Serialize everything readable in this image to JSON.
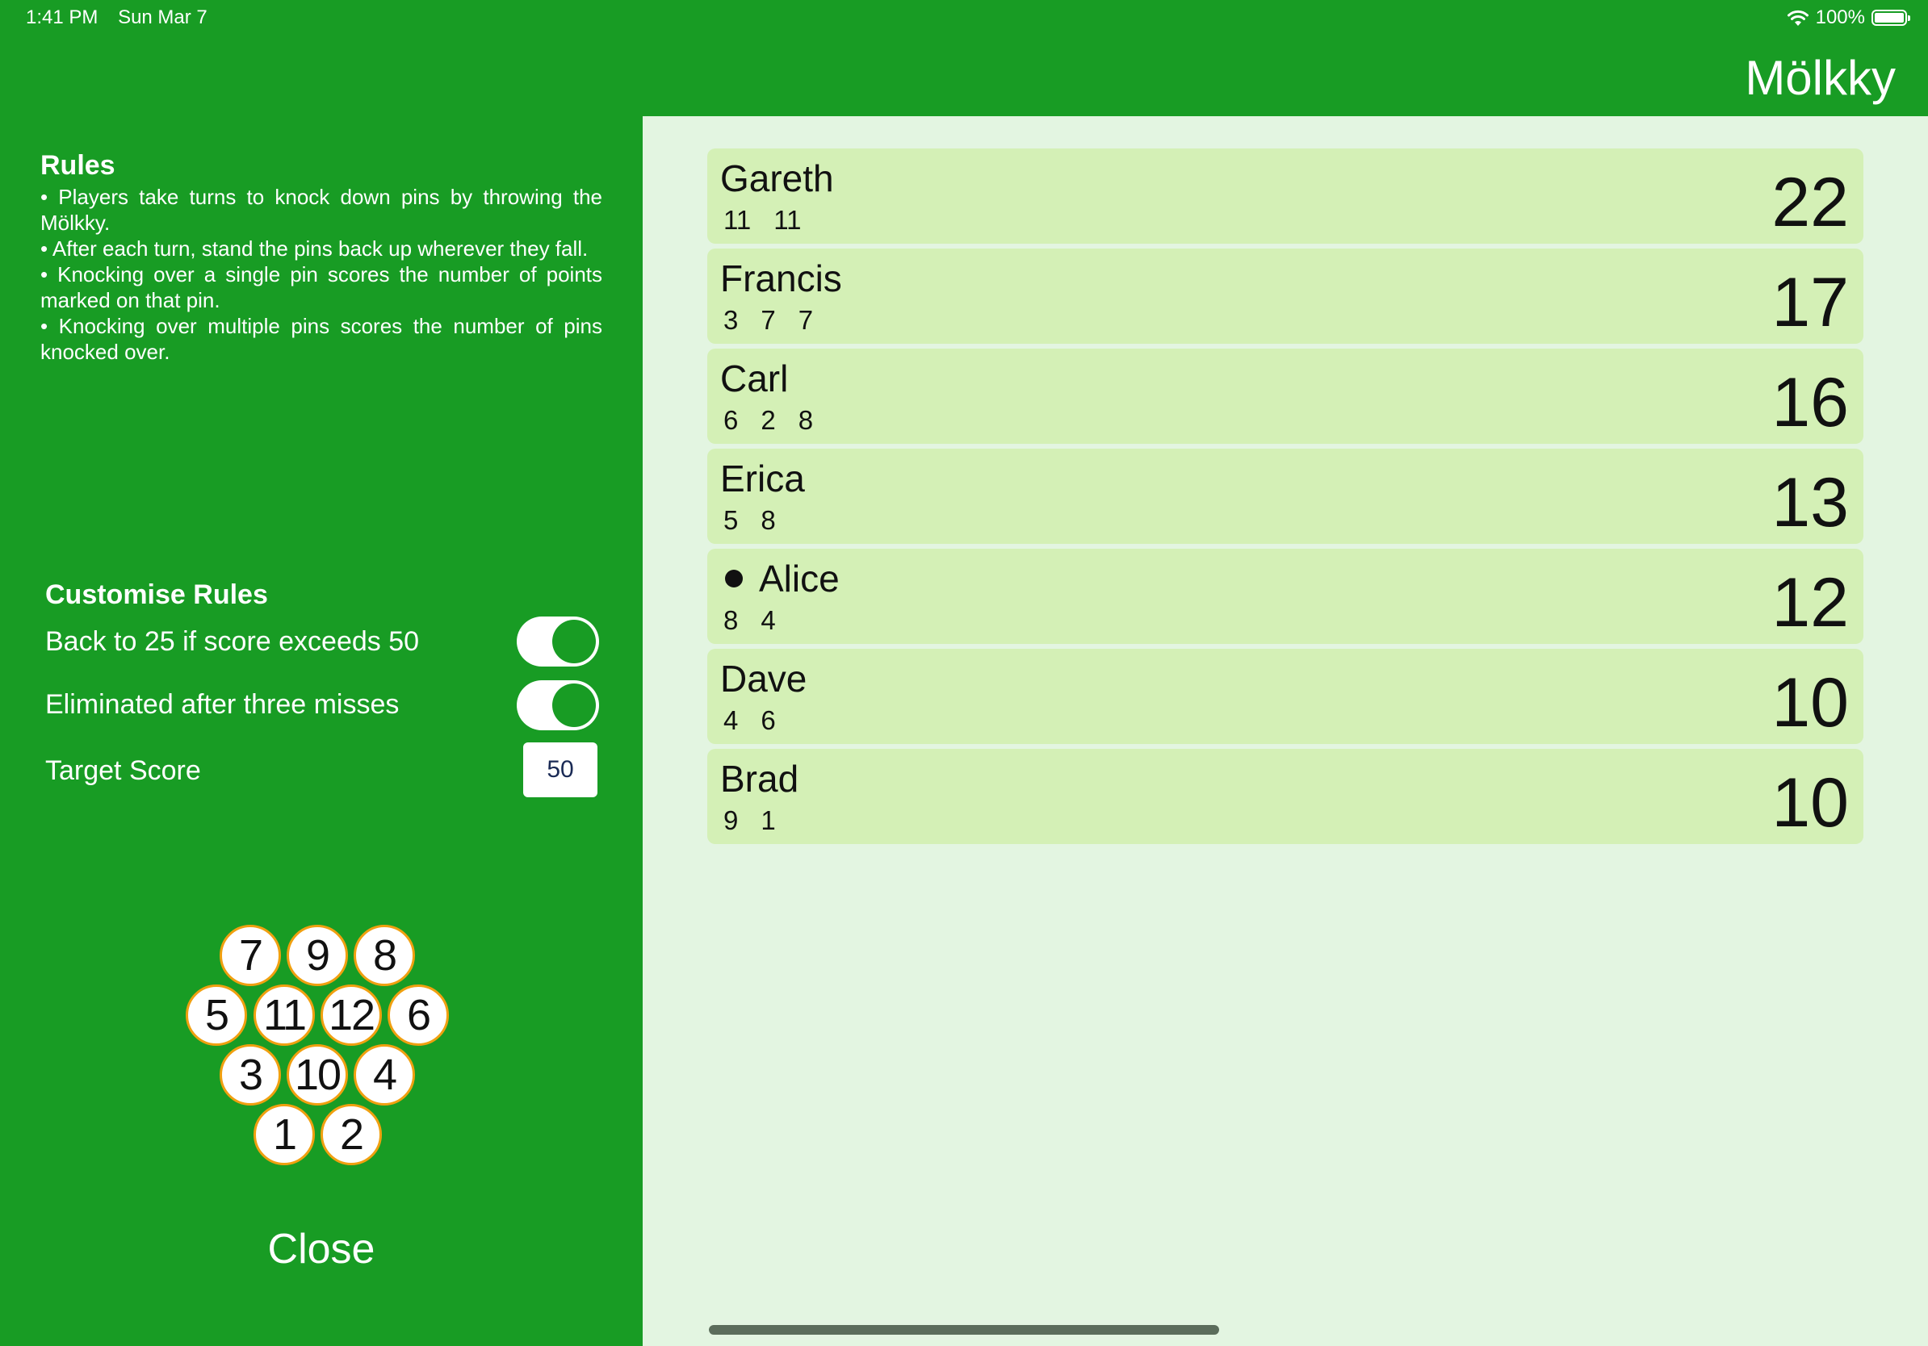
{
  "status_bar": {
    "time": "1:41 PM",
    "date": "Sun Mar 7",
    "battery": "100%",
    "wifi_icon": "wifi-icon",
    "battery_icon": "battery-icon"
  },
  "app_title": "Mölkky",
  "colors": {
    "sidebar_green": "#189c24",
    "row_green": "#d4f0b6",
    "background_light": "#e3f5e1",
    "pin_border": "#f0a010"
  },
  "rules": {
    "heading": "Rules",
    "items": [
      "• Players take turns to knock down pins by throwing the Mölkky.",
      "• After each turn, stand the pins back up wherever they fall.",
      "• Knocking over a single pin scores the number of points marked on that pin.",
      "• Knocking over multiple pins scores the number of pins knocked over."
    ]
  },
  "customise": {
    "heading": "Customise Rules",
    "options": [
      {
        "label": "Back to 25 if score exceeds 50",
        "enabled": true
      },
      {
        "label": "Eliminated after three misses",
        "enabled": true
      }
    ],
    "target_label": "Target Score",
    "target_value": "50"
  },
  "pins": [
    "7",
    "9",
    "8",
    "5",
    "11",
    "12",
    "6",
    "3",
    "10",
    "4",
    "1",
    "2"
  ],
  "close_label": "Close",
  "players": [
    {
      "name": "Gareth",
      "throws": [
        "11",
        "11"
      ],
      "total": "22",
      "current": false
    },
    {
      "name": "Francis",
      "throws": [
        "3",
        "7",
        "7"
      ],
      "total": "17",
      "current": false
    },
    {
      "name": "Carl",
      "throws": [
        "6",
        "2",
        "8"
      ],
      "total": "16",
      "current": false
    },
    {
      "name": "Erica",
      "throws": [
        "5",
        "8"
      ],
      "total": "13",
      "current": false
    },
    {
      "name": "Alice",
      "throws": [
        "8",
        "4"
      ],
      "total": "12",
      "current": true
    },
    {
      "name": "Dave",
      "throws": [
        "4",
        "6"
      ],
      "total": "10",
      "current": false
    },
    {
      "name": "Brad",
      "throws": [
        "9",
        "1"
      ],
      "total": "10",
      "current": false
    }
  ]
}
